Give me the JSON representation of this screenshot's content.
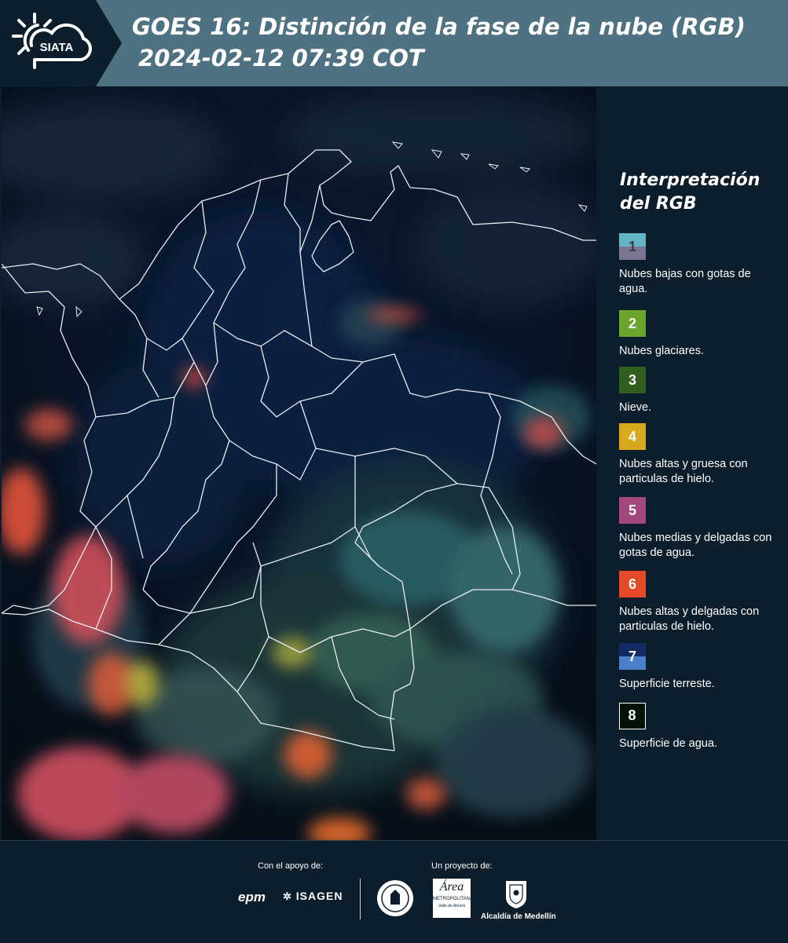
{
  "header": {
    "logo_text": "SIATA",
    "title_line1": "GOES 16: Distinción de la fase de la nube (RGB)",
    "title_line2": "2024-02-12 07:39 COT"
  },
  "legend": {
    "title_line1": "Interpretación",
    "title_line2": "del RGB",
    "items": [
      {
        "number": "1",
        "label": "Nubes bajas con gotas de agua.",
        "color_top": "#62b6c4",
        "color_bottom": "#7a7590",
        "text_color": "#3b3f4a"
      },
      {
        "number": "2",
        "label": "Nubes glaciares.",
        "color_top": "#6ba52e",
        "color_bottom": "#6ba52e",
        "text_color": "#ffffff"
      },
      {
        "number": "3",
        "label": "Nieve.",
        "color_top": "#2f5e1e",
        "color_bottom": "#2f5e1e",
        "text_color": "#ffffff"
      },
      {
        "number": "4",
        "label": "Nubes altas y gruesa con particulas de hielo.",
        "color_top": "#d9a91d",
        "color_bottom": "#d9a91d",
        "text_color": "#ffffff"
      },
      {
        "number": "5",
        "label": "Nubes medias y delgadas con gotas de agua.",
        "color_top": "#a3487b",
        "color_bottom": "#a3487b",
        "text_color": "#ffffff"
      },
      {
        "number": "6",
        "label": "Nubes altas y delgadas con particulas de hielo.",
        "color_top": "#e34b28",
        "color_bottom": "#e34b28",
        "text_color": "#ffffff"
      },
      {
        "number": "7",
        "label": "Superficie terreste.",
        "color_top": "#142a66",
        "color_bottom": "#4c7fc9",
        "text_color": "#ffffff"
      },
      {
        "number": "8",
        "label": "Superficie de agua.",
        "color_top": "#051208",
        "color_bottom": "#051208",
        "text_color": "#ffffff"
      }
    ]
  },
  "footer": {
    "support_label": "Con el apoyo de:",
    "project_label": "Un proyecto de:",
    "sponsor_1": "epm",
    "sponsor_2": "ISAGEN",
    "partner_area_line1": "Área",
    "partner_area_line2": "METROPOLITANA",
    "partner_area_line3": "Valle de Aburrá",
    "partner_alcaldia": "Alcaldía de Medellín"
  }
}
